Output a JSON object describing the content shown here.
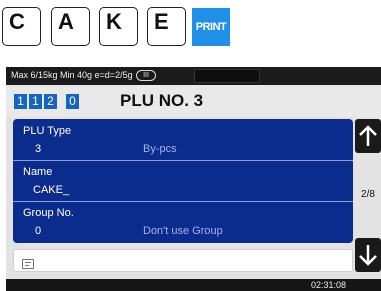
{
  "keys": [
    {
      "label": "C"
    },
    {
      "label": "A"
    },
    {
      "label": "K"
    },
    {
      "label": "E"
    }
  ],
  "print_key": {
    "label": "PRINT"
  },
  "status": {
    "scale_info": "Max 6/15kg Min 40g e=d=2/5g",
    "range_badge": "III"
  },
  "header": {
    "digits": [
      "1",
      "1",
      "2",
      "0"
    ],
    "title": "PLU NO. 3"
  },
  "fields": [
    {
      "label": "PLU Type",
      "value": "3",
      "desc": "By-pcs"
    },
    {
      "label": "Name",
      "value": "CAKE_"
    },
    {
      "label": "Group No.",
      "value": "0",
      "desc": "Don't use Group"
    }
  ],
  "memo": {
    "icon": "memo-icon"
  },
  "navigation": {
    "up_icon": "arrow-up-icon",
    "down_icon": "arrow-down-icon",
    "page": "2/8"
  },
  "clock": "02:31:08",
  "colors": {
    "panel": "#0b2c8d",
    "digit": "#1565c0",
    "print": "#1f8fe8",
    "status_bar": "#1b1b1b"
  }
}
